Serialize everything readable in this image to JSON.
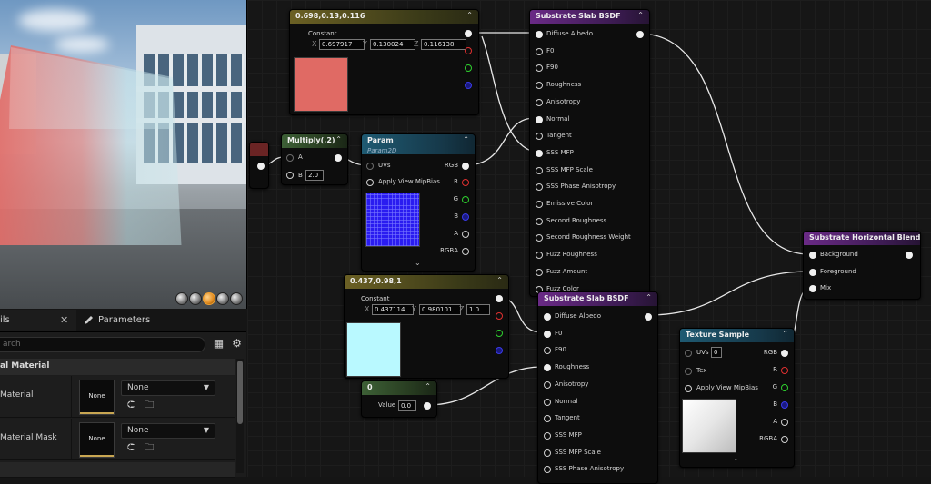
{
  "viewport": {
    "preview_spheres": [
      "sphere",
      "cylinder",
      "plane",
      "cube",
      "custom"
    ],
    "selected_preview": "plane"
  },
  "details": {
    "tab_details": "ils",
    "tab_parameters": "Parameters",
    "search_placeholder": "arch",
    "category": "al Material",
    "rows": [
      {
        "label": "Material",
        "thumb": "None",
        "combo": "None"
      },
      {
        "label": "Material Mask",
        "thumb": "None",
        "combo": "None"
      }
    ]
  },
  "graph": {
    "const1": {
      "title": "0.698,0.13,0.116",
      "label": "Constant",
      "x": "0.697917",
      "y": "0.130024",
      "z": "0.116138",
      "swatch_color": "#e06a64"
    },
    "const2": {
      "title": "0.437,0.98,1",
      "label": "Constant",
      "x": "0.437114",
      "y": "0.980101",
      "z": "1.0",
      "swatch_color": "#b9f9ff"
    },
    "scalar": {
      "title": "0",
      "label": "Value",
      "value": "0.0"
    },
    "multiply": {
      "title": "Multiply(,2)",
      "a": "A",
      "b": "B",
      "b_value": "2.0"
    },
    "param": {
      "title": "Param",
      "subtitle": "Param2D",
      "uvs": "UVs",
      "mipbias": "Apply View MipBias",
      "outputs": [
        "RGB",
        "R",
        "G",
        "B",
        "A",
        "RGBA"
      ]
    },
    "slab1": {
      "title": "Substrate Slab BSDF",
      "inputs": [
        "Diffuse Albedo",
        "F0",
        "F90",
        "Roughness",
        "Anisotropy",
        "Normal",
        "Tangent",
        "SSS MFP",
        "SSS MFP Scale",
        "SSS Phase Anisotropy",
        "Emissive Color",
        "Second Roughness",
        "Second Roughness Weight",
        "Fuzz Roughness",
        "Fuzz Amount",
        "Fuzz Color"
      ]
    },
    "slab2": {
      "title": "Substrate Slab BSDF",
      "inputs": [
        "Diffuse Albedo",
        "F0",
        "F90",
        "Roughness",
        "Anisotropy",
        "Normal",
        "Tangent",
        "SSS MFP",
        "SSS MFP Scale",
        "SSS Phase Anisotropy"
      ]
    },
    "blend": {
      "title": "Substrate Horizontal Blend",
      "inputs": [
        "Background",
        "Foreground",
        "Mix"
      ]
    },
    "texture": {
      "title": "Texture Sample",
      "uvs": "UVs",
      "uvs_value": "0",
      "tex": "Tex",
      "mipbias": "Apply View MipBias",
      "outputs": [
        "RGB",
        "R",
        "G",
        "B",
        "A",
        "RGBA"
      ]
    }
  }
}
